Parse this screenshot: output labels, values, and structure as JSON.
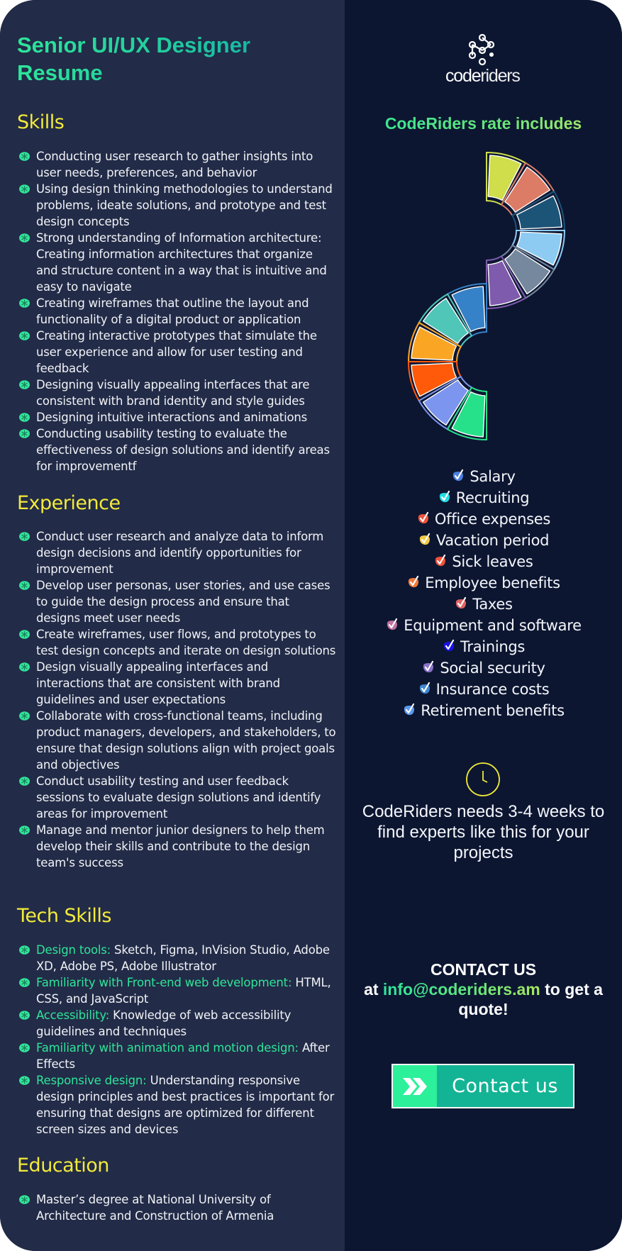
{
  "resume": {
    "title": "Senior UI/UX Designer Resume",
    "skills": {
      "heading": "Skills",
      "items": [
        "Conducting user research to gather insights into user needs, preferences, and behavior",
        "Using design thinking methodologies to understand problems, ideate solutions, and prototype and test design concepts",
        "Strong understanding of Information architecture: Creating information architectures that organize and structure content in a way that is intuitive and easy to navigate",
        "Creating wireframes that outline the layout and functionality of a digital product or application",
        "Creating interactive prototypes that simulate the user experience and allow for user testing and feedback",
        "Designing visually appealing interfaces that are consistent with brand identity and style guides",
        "Designing intuitive interactions and animations",
        "Conducting usability testing to evaluate the effectiveness of design solutions and identify areas for improvementf"
      ]
    },
    "experience": {
      "heading": "Experience",
      "items": [
        "Conduct user research and analyze data to inform design decisions and identify opportunities for improvement",
        "Develop user personas, user stories, and use cases to guide the design process and ensure that designs meet user needs",
        "Create wireframes, user flows, and prototypes to test design concepts and iterate on design solutions",
        "Design visually appealing interfaces and interactions that are consistent with brand guidelines and user expectations",
        "Collaborate with cross-functional teams, including product managers, developers, and stakeholders, to ensure that design solutions align with project goals and objectives",
        "Conduct usability testing and user feedback sessions to evaluate design solutions and identify areas for improvement",
        "Manage and mentor junior designers to help them develop their skills and contribute to the design team's success"
      ]
    },
    "tech_skills": {
      "heading": "Tech Skills",
      "items": [
        {
          "label": "Design tools:",
          "text": " Sketch, Figma, InVision Studio, Adobe XD, Adobe PS, Adobe Illustrator"
        },
        {
          "label": "Familiarity with Front-end web development:",
          "text": " HTML, CSS, and JavaScript"
        },
        {
          "label": "Accessibility:",
          "text": " Knowledge of web accessibility guidelines and techniques"
        },
        {
          "label": "Familiarity with animation and motion design:",
          "text": " After Effects"
        },
        {
          "label": "Responsive design:",
          "text": " Understanding responsive design principles and best practices is important for ensuring that designs are optimized for different screen sizes and devices"
        }
      ]
    },
    "education": {
      "heading": "Education",
      "items": [
        "Master’s degree at National University of Architecture and Construction of Armenia"
      ]
    },
    "bullet_icon": "green-badge-icon",
    "bullet_color": "#2ee59a"
  },
  "sidebar": {
    "logo": {
      "bold": "code",
      "light": "riders",
      "icon": "network-nodes-icon"
    },
    "rate_title": "CodeRiders rate includes",
    "spiral_segments": [
      {
        "color": "#cfde4a"
      },
      {
        "color": "#dc7c67"
      },
      {
        "color": "#1c5478"
      },
      {
        "color": "#8dcbf3"
      },
      {
        "color": "#75889d"
      },
      {
        "color": "#7f5bad"
      },
      {
        "color": "#3682c8"
      },
      {
        "color": "#4fc6b8"
      },
      {
        "color": "#fba524"
      },
      {
        "color": "#fe5a0a"
      },
      {
        "color": "#7c96ef"
      },
      {
        "color": "#27e08a"
      }
    ],
    "includes": [
      {
        "label": "Salary",
        "color": "#4a80e0"
      },
      {
        "label": "Recruiting",
        "color": "#22dde6"
      },
      {
        "label": "Office expenses",
        "color": "#f2513a"
      },
      {
        "label": "Vacation period",
        "color": "#f4c843"
      },
      {
        "label": "Sick leaves",
        "color": "#f2513a"
      },
      {
        "label": "Employee benefits",
        "color": "#f07a3c"
      },
      {
        "label": "Taxes",
        "color": "#e06566"
      },
      {
        "label": "Equipment and software",
        "color": "#c072a0"
      },
      {
        "label": "Trainings",
        "color": "#1a12e8"
      },
      {
        "label": "Social security",
        "color": "#8a72c8"
      },
      {
        "label": "Insurance costs",
        "color": "#3f86d0"
      },
      {
        "label": "Retirement benefits",
        "color": "#5d9af0"
      }
    ],
    "timeline_text": "CodeRiders needs 3-4 weeks to find experts like this for your projects",
    "contact_heading": "CONTACT US",
    "contact_prefix": "at ",
    "contact_email": "info@coderiders.am",
    "contact_suffix": " to get a quote!",
    "cta_label": "Contact us"
  },
  "colors": {
    "left_bg": "#222b47",
    "right_bg": "#0c1631",
    "heading_yellow": "#f2ea3a",
    "accent_green": "#2ee59a"
  }
}
